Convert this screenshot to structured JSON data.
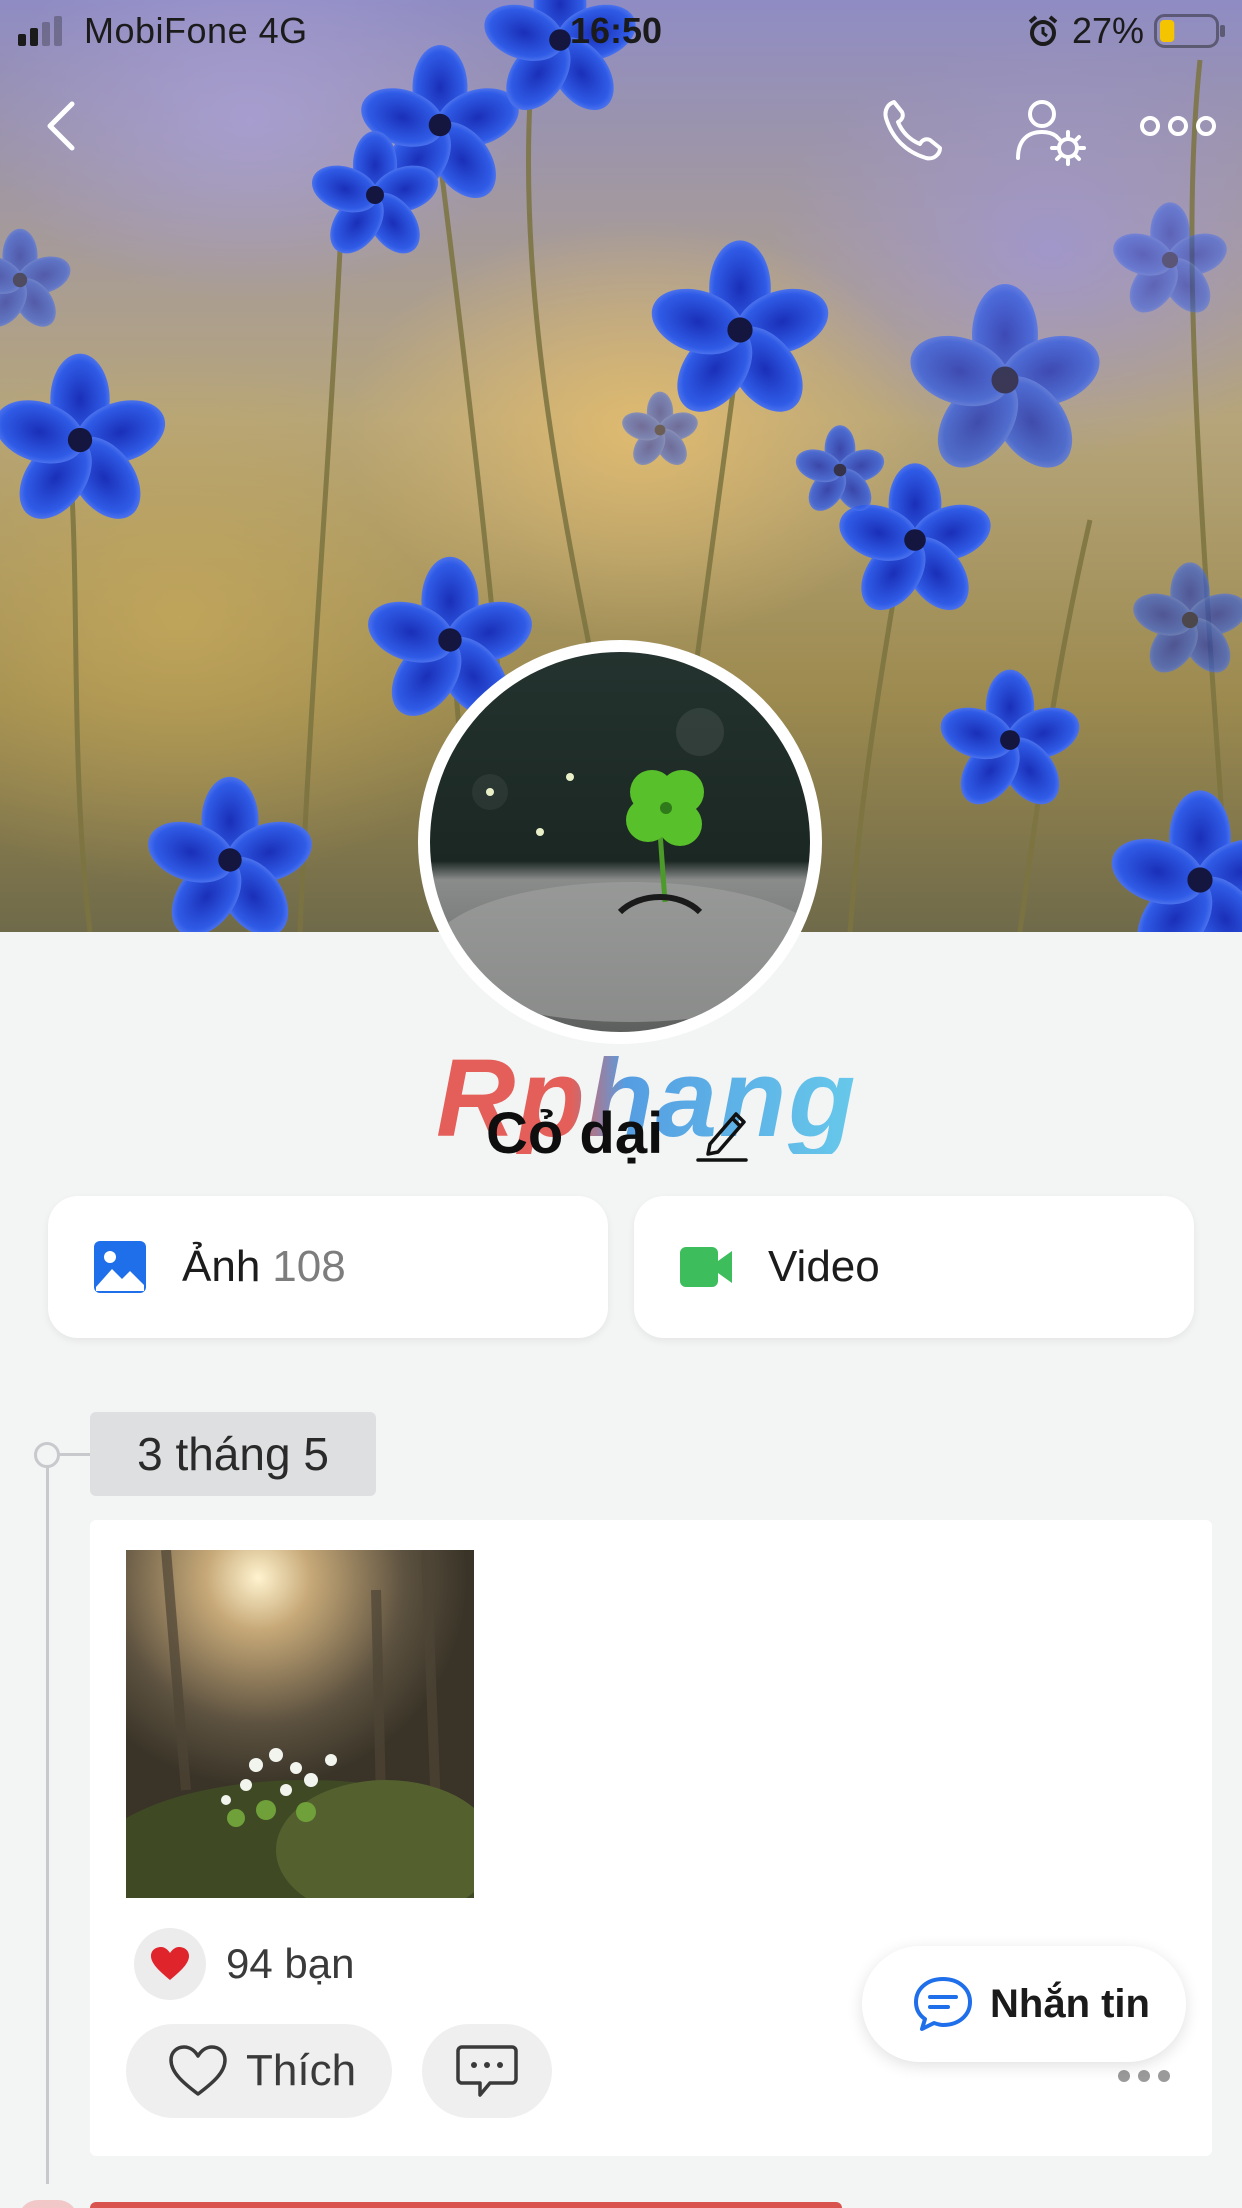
{
  "status_bar": {
    "carrier": "MobiFone   4G",
    "time": "16:50",
    "battery": "27%",
    "battery_level": 0.27
  },
  "nav": {
    "back_icon": "chevron-left-icon",
    "call_icon": "phone-icon",
    "settings_icon": "user-settings-icon",
    "more_icon": "more-horizontal-icon"
  },
  "profile": {
    "name": "Cỏ dại",
    "watermark": "Rphang",
    "edit_icon": "pencil-icon"
  },
  "media": {
    "photos_label": "Ảnh",
    "photos_count": "108",
    "video_label": "Video"
  },
  "timeline": {
    "date": "3 tháng 5",
    "post": {
      "reaction_count": "94 bạn",
      "like_label": "Thích",
      "comment_icon": "comment-icon",
      "more_icon": "more-horizontal-icon"
    }
  },
  "floating": {
    "message_label": "Nhắn tin"
  },
  "colors": {
    "accent_blue": "#1f6feb",
    "video_green": "#3dbd5b",
    "heart_red": "#e0242c"
  }
}
